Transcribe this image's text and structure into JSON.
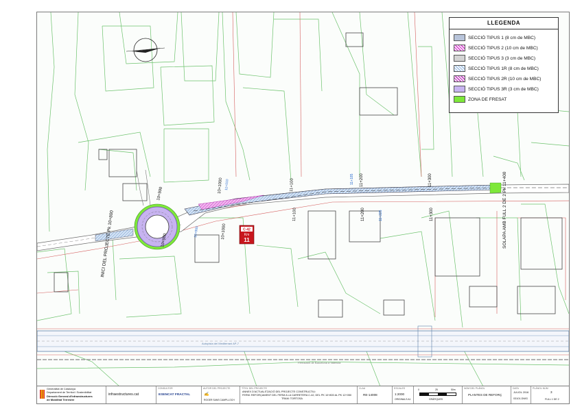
{
  "legend": {
    "title": "LLEGENDA",
    "items": [
      {
        "label": "SECCIÓ TIPUS 1 (8 cm de MBC)",
        "color": "#b8c4da",
        "pattern": "solid"
      },
      {
        "label": "SECCIÓ TIPUS 2 (10 cm de MBC)",
        "color": "#d94fd3",
        "pattern": "hatch"
      },
      {
        "label": "SECCIÓ TIPUS 3 (3 cm de MBC)",
        "color": "#d4d4d4",
        "pattern": "solid"
      },
      {
        "label": "SECCIÓ TIPUS 1R (8 cm de MBC)",
        "color": "#a9c6e6",
        "pattern": "hatch"
      },
      {
        "label": "SECCIÓ TIPUS 2R (10 cm de MBC)",
        "color": "#c44bc4",
        "pattern": "hatch"
      },
      {
        "label": "SECCIÓ TIPUS 3R (3 cm de MBC)",
        "color": "#c7b3f0",
        "pattern": "solid"
      },
      {
        "label": "ZONA DE FRESAT",
        "color": "#7ee83a",
        "pattern": "solid"
      }
    ]
  },
  "map": {
    "start_label": "INICI DEL PROJECTE Pk 10+800",
    "end_label": "SOLAPA AMB FULL 2 DE 2 Pk 11+400",
    "pk_labels": [
      "10+900",
      "10+900",
      "10+1000",
      "10+1000",
      "11+100",
      "11+100",
      "11+200",
      "11+200",
      "11+300",
      "11+300"
    ],
    "blue_labels": [
      "11+010",
      "10+960",
      "11+185",
      "11+225"
    ],
    "km_sign": {
      "road": "C-42",
      "km_word": "Km",
      "km_number": "11"
    },
    "road_names": [
      "Autopista del Mediterrani AP-7",
      "Ferrocarril de Barcelona a Valencia"
    ]
  },
  "title_block": {
    "org_line1": "Generalitat de Catalunya",
    "org_line2": "Departament de Territori i Sostenibilitat",
    "org_line3": "Direcció General d'Infraestructures",
    "org_line4": "de Mobilitat Terrestre",
    "website": "infraestructures.cat",
    "consultor_caption": "CONSULTOR",
    "consultor_name": "ESENCAT FRACTAL",
    "autor_caption": "AUTOR DEL PROJECTE",
    "autor_name": "ROGER SANS CAMPLLOCH",
    "titol_caption": "TÍTOL DEL PROJECTE",
    "titol_line1": "ANNEX D'ACTUALITZACIÓ DEL PROJECTE CONSTRUCTIU:",
    "titol_line2": "FERM: REFORÇAMENT DEL FERM A LA CARRETERA C-42, DEL PK 10+800 AL PK 12+050",
    "titol_line3": "TRAM: TORTOSA",
    "clau_caption": "CLAU",
    "clau": "RE-14008",
    "escales_caption": "ESCALES",
    "escala": "1:2000",
    "originals": "ORIGINALS A1",
    "scale_ticks": [
      "0",
      "25",
      "50m"
    ],
    "grafiques": "GRÀFIQUES",
    "nom_plano_caption": "NOM DEL PLÀNOL",
    "nom_plano": "PLANTES DE REFORÇ",
    "data_caption": "DATA",
    "data": "JULIOL 2016",
    "plano_num_caption": "PLÀNOL NÚM",
    "plano_num": "3",
    "num_plano_code": "03101.DWG",
    "full": "FULL 1 DE 2"
  }
}
